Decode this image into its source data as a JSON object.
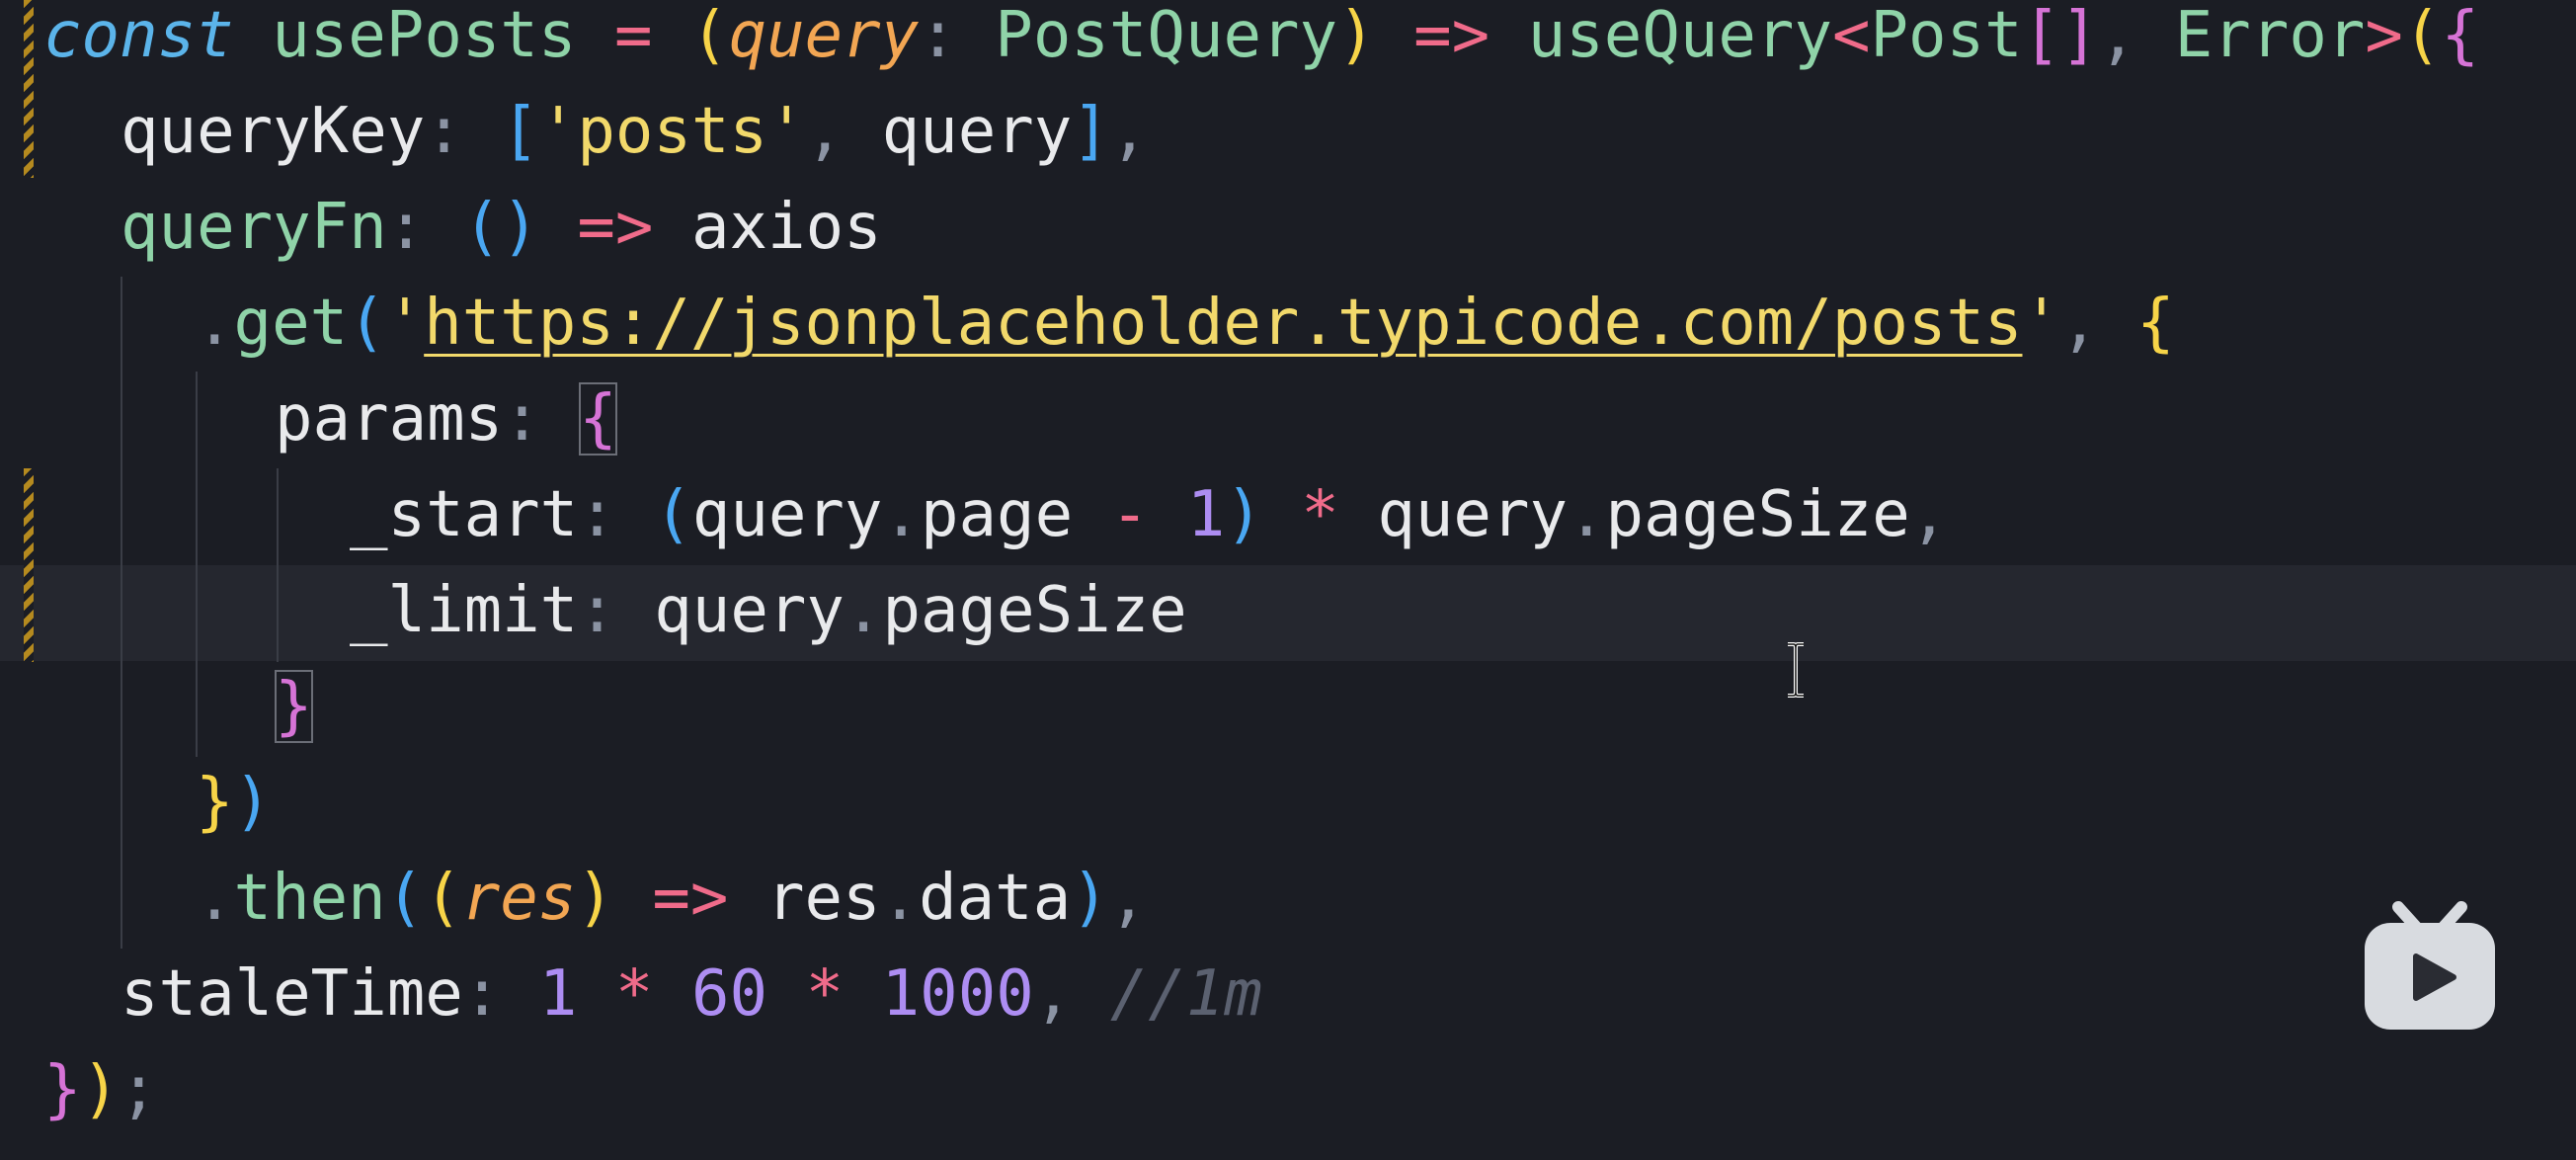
{
  "editor": {
    "lines": [
      {
        "tokens": [
          "const",
          "usePosts",
          "=",
          "(",
          "query",
          ":",
          "PostQuery",
          ")",
          "=>",
          "useQuery",
          "<",
          "Post",
          "[]",
          ",",
          "Error",
          ">",
          "(",
          "{"
        ]
      },
      {
        "tokens": [
          "queryKey",
          ":",
          "[",
          "'",
          "posts",
          "'",
          ",",
          "query",
          "]",
          ","
        ]
      },
      {
        "tokens": [
          "queryFn",
          ":",
          "()",
          "=>",
          "axios"
        ]
      },
      {
        "tokens": [
          ".",
          "get",
          "(",
          "'",
          "https://jsonplaceholder.typicode.com/posts",
          "'",
          ",",
          "{"
        ]
      },
      {
        "tokens": [
          "params",
          ":",
          "{"
        ]
      },
      {
        "tokens": [
          "_start",
          ":",
          "(",
          "query",
          ".",
          "page",
          "-",
          "1",
          ")",
          "*",
          "query",
          ".",
          "pageSize",
          ","
        ]
      },
      {
        "tokens": [
          "_limit",
          ":",
          "query",
          ".",
          "pageSize"
        ]
      },
      {
        "tokens": [
          "}"
        ]
      },
      {
        "tokens": [
          "}",
          ")"
        ]
      },
      {
        "tokens": [
          ".",
          "then",
          "(",
          "(",
          "res",
          ")",
          "=>",
          "res",
          ".",
          "data",
          ")",
          ","
        ]
      },
      {
        "tokens": [
          "staleTime",
          ":",
          "1",
          "*",
          "60",
          "*",
          "1000",
          ",",
          "//1m"
        ]
      },
      {
        "tokens": [
          "}",
          ")",
          ";"
        ]
      }
    ]
  },
  "colors": {
    "background": "#1b1d24",
    "keyword": "#5bb4ea",
    "function": "#8fd3a8",
    "operator": "#f06b8a",
    "string": "#f2d96b",
    "number": "#ad8df2",
    "parameter": "#f2a653",
    "comment": "#5b6170"
  },
  "icons": {
    "text_cursor": "i-beam-cursor-icon",
    "watermark": "bilibili-tv-logo-icon"
  }
}
